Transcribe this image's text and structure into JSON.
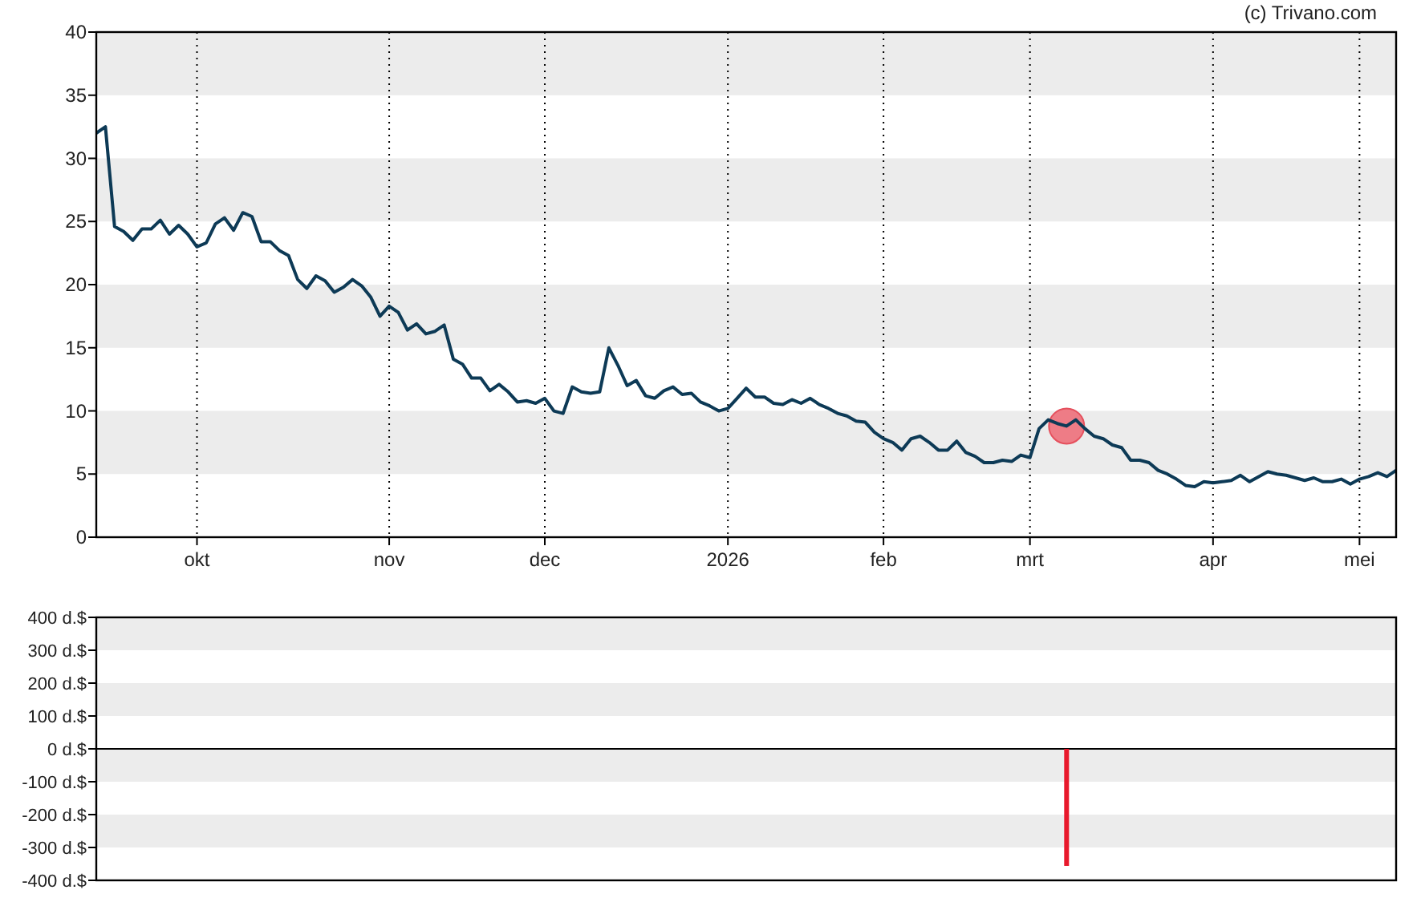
{
  "credit": "(c) Trivano.com",
  "price_chart": {
    "chart_data": {
      "type": "line",
      "ylim": [
        0,
        40
      ],
      "yticks": [
        40,
        35,
        30,
        25,
        20,
        15,
        10,
        5,
        0
      ],
      "categories": [
        null,
        null,
        null,
        null,
        null,
        null,
        null,
        null,
        null,
        null,
        null,
        "okt",
        null,
        null,
        null,
        null,
        null,
        null,
        null,
        null,
        null,
        null,
        null,
        null,
        null,
        null,
        null,
        null,
        null,
        null,
        null,
        null,
        "nov",
        null,
        null,
        null,
        null,
        null,
        null,
        null,
        null,
        null,
        null,
        null,
        null,
        null,
        null,
        null,
        null,
        "dec",
        null,
        null,
        null,
        null,
        null,
        null,
        null,
        null,
        null,
        null,
        null,
        null,
        null,
        null,
        null,
        null,
        null,
        null,
        null,
        "2026",
        null,
        null,
        null,
        null,
        null,
        null,
        null,
        null,
        null,
        null,
        null,
        null,
        null,
        null,
        null,
        null,
        "feb",
        null,
        null,
        null,
        null,
        null,
        null,
        null,
        null,
        null,
        null,
        null,
        null,
        null,
        null,
        null,
        "mrt",
        null,
        null,
        null,
        null,
        null,
        null,
        null,
        null,
        null,
        null,
        null,
        null,
        null,
        null,
        null,
        null,
        null,
        null,
        null,
        "apr",
        null,
        null,
        null,
        null,
        null,
        null,
        null,
        null,
        null,
        null,
        null,
        null,
        null,
        null,
        null,
        "mei",
        null,
        null,
        null,
        null
      ],
      "series": [
        {
          "color": "#0d3a56",
          "values": [
            32,
            32.5,
            24.6,
            24.2,
            23.5,
            24.4,
            24.4,
            25.1,
            24,
            24.7,
            24,
            23,
            23.3,
            24.8,
            25.3,
            24.3,
            25.7,
            25.4,
            23.4,
            23.4,
            22.7,
            22.3,
            20.4,
            19.7,
            20.7,
            20.3,
            19.4,
            19.8,
            20.4,
            19.9,
            19,
            17.5,
            18.3,
            17.8,
            16.4,
            16.9,
            16.1,
            16.3,
            16.8,
            14.1,
            13.7,
            12.6,
            12.6,
            11.6,
            12.1,
            11.5,
            10.7,
            10.8,
            10.6,
            11,
            10,
            9.8,
            11.9,
            11.5,
            11.4,
            11.5,
            15,
            13.6,
            12,
            12.4,
            11.2,
            11,
            11.6,
            11.9,
            11.3,
            11.4,
            10.7,
            10.4,
            10,
            10.2,
            11,
            11.8,
            11.1,
            11.1,
            10.6,
            10.5,
            10.9,
            10.6,
            11,
            10.5,
            10.2,
            9.8,
            9.6,
            9.2,
            9.1,
            8.3,
            7.8,
            7.5,
            6.9,
            7.8,
            8,
            7.5,
            6.9,
            6.9,
            7.6,
            6.7,
            6.4,
            5.9,
            5.9,
            6.1,
            6,
            6.5,
            6.3,
            8.6,
            9.3,
            9,
            8.8,
            9.3,
            8.6,
            8,
            7.8,
            7.3,
            7.1,
            6.1,
            6.1,
            5.9,
            5.3,
            5,
            4.6,
            4.1,
            4,
            4.4,
            4.3,
            4.4,
            4.5,
            4.9,
            4.4,
            4.8,
            5.2,
            5,
            4.9,
            4.7,
            4.5,
            4.7,
            4.4,
            4.4,
            4.6,
            4.2,
            4.6,
            4.8,
            5.1,
            4.8,
            5.3
          ]
        }
      ]
    }
  },
  "insider_chart": {
    "chart_data": {
      "type": "bar",
      "ylim": [
        -400,
        400
      ],
      "yticks": [
        {
          "value": 400,
          "label": "400 d.$"
        },
        {
          "value": 300,
          "label": "300 d.$"
        },
        {
          "value": 200,
          "label": "200 d.$"
        },
        {
          "value": 100,
          "label": "100 d.$"
        },
        {
          "value": 0,
          "label": "0 d.$"
        },
        {
          "value": -100,
          "label": "-100 d.$"
        },
        {
          "value": -200,
          "label": "-200 d.$"
        },
        {
          "value": -300,
          "label": "-300 d.$"
        },
        {
          "value": -400,
          "label": "-400 d.$"
        }
      ],
      "categories": [
        null,
        null,
        null,
        null,
        null,
        null,
        null,
        null,
        null,
        null,
        null,
        null,
        null,
        null,
        null,
        null,
        null,
        null,
        null,
        null,
        null,
        null,
        null,
        null,
        null,
        null,
        null,
        null,
        null,
        null,
        null,
        null,
        null,
        null,
        null,
        null,
        null,
        null,
        null,
        null,
        null,
        null,
        null,
        null,
        null,
        null,
        null,
        null,
        null,
        null,
        null,
        null,
        null,
        null,
        null,
        null,
        null,
        null,
        null,
        null,
        null,
        null,
        null,
        null,
        null,
        null,
        null,
        null,
        null,
        null,
        null,
        null,
        null,
        null,
        null,
        null,
        null,
        null,
        null,
        null,
        null,
        null,
        null,
        null,
        null,
        null,
        null,
        null,
        null,
        null,
        null,
        null,
        null,
        null,
        null,
        null,
        null,
        null,
        null,
        null,
        null,
        null,
        null,
        null,
        null,
        null,
        null,
        null,
        null,
        null,
        null,
        null,
        null,
        null,
        null,
        null,
        null,
        null,
        null,
        null,
        null,
        null,
        null,
        null,
        null,
        null,
        null,
        null,
        null,
        null,
        null,
        null,
        null,
        null,
        null,
        null,
        null,
        null,
        null,
        null,
        null,
        null,
        null
      ],
      "series": [
        {
          "color": "#e8192c",
          "values": [
            null,
            null,
            null,
            null,
            null,
            null,
            null,
            null,
            null,
            null,
            null,
            null,
            null,
            null,
            null,
            null,
            null,
            null,
            null,
            null,
            null,
            null,
            null,
            null,
            null,
            null,
            null,
            null,
            null,
            null,
            null,
            null,
            null,
            null,
            null,
            null,
            null,
            null,
            null,
            null,
            null,
            null,
            null,
            null,
            null,
            null,
            null,
            null,
            null,
            null,
            null,
            null,
            null,
            null,
            null,
            null,
            null,
            null,
            null,
            null,
            null,
            null,
            null,
            null,
            null,
            null,
            null,
            null,
            null,
            null,
            null,
            null,
            null,
            null,
            null,
            null,
            null,
            null,
            null,
            null,
            null,
            null,
            null,
            null,
            null,
            null,
            null,
            null,
            null,
            null,
            null,
            null,
            null,
            null,
            null,
            null,
            null,
            null,
            null,
            null,
            null,
            null,
            null,
            null,
            null,
            null,
            -356,
            null,
            null,
            null,
            null,
            null,
            null,
            null,
            null,
            null,
            null,
            null,
            null,
            null,
            null,
            null,
            null,
            null,
            null,
            null,
            null,
            null,
            null,
            null,
            null,
            null,
            null,
            null,
            null,
            null,
            null,
            null,
            null,
            null,
            null,
            null,
            null
          ]
        }
      ]
    }
  }
}
